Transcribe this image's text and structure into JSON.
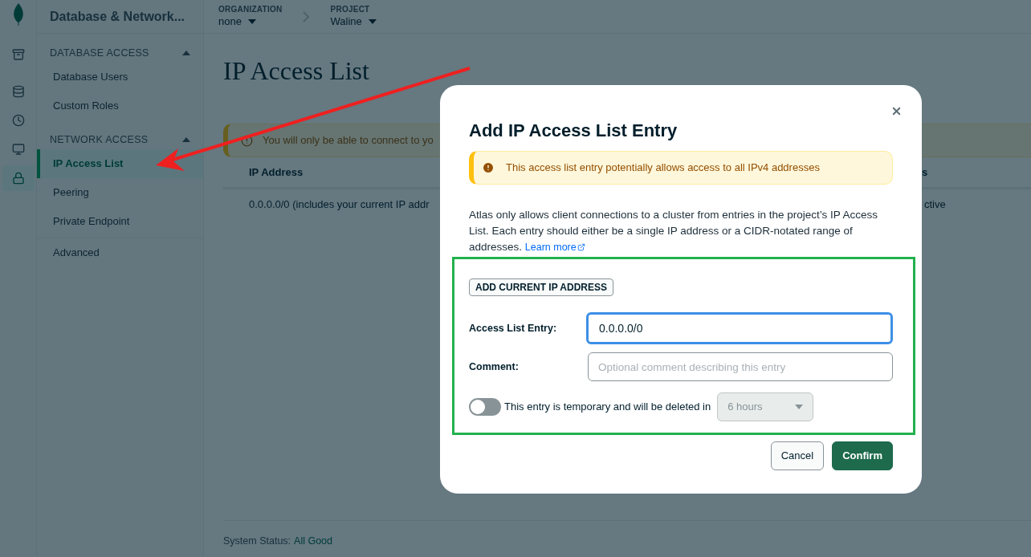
{
  "rail": [
    {
      "selected": false
    },
    {
      "selected": false
    },
    {
      "selected": false
    },
    {
      "selected": false
    },
    {
      "selected": true
    }
  ],
  "sidebar": {
    "title": "Database & Network...",
    "sections": [
      {
        "heading": "DATABASE ACCESS",
        "expanded": true,
        "items": [
          {
            "label": "Database Users",
            "selected": false
          },
          {
            "label": "Custom Roles",
            "selected": false
          }
        ]
      },
      {
        "heading": "NETWORK ACCESS",
        "expanded": true,
        "items": [
          {
            "label": "IP Access List",
            "selected": true
          },
          {
            "label": "Peering",
            "selected": false
          },
          {
            "label": "Private Endpoint",
            "selected": false
          }
        ]
      }
    ],
    "footer_items": [
      {
        "label": "Advanced",
        "selected": false
      }
    ]
  },
  "breadcrumb": [
    {
      "label": "ORGANIZATION",
      "value": "none"
    },
    {
      "label": "PROJECT",
      "value": "Waline"
    }
  ],
  "page": {
    "title": "IP Access List",
    "banner": "You will only be able to connect to yo",
    "table": {
      "columns": [
        "IP Address",
        "s"
      ],
      "rows": [
        [
          "0.0.0.0/0 (includes your current IP addr",
          "ctive"
        ]
      ]
    },
    "status_label": "System Status:",
    "status_value": "All Good"
  },
  "dialog": {
    "title": "Add IP Access List Entry",
    "warning": "This access list entry potentially allows access to all IPv4 addresses",
    "description": "Atlas only allows client connections to a cluster from entries in the project’s IP Access List. Each entry should either be a single IP address or a CIDR-notated range of addresses.",
    "link": "Learn more",
    "add_current_button": "ADD CURRENT IP ADDRESS",
    "entry": {
      "label": "Access List Entry:",
      "value": "0.0.0.0/0",
      "focused": true
    },
    "comment": {
      "label": "Comment:",
      "placeholder": "Optional comment describing this entry"
    },
    "temporary": {
      "on": false,
      "label": "This entry is temporary and will be deleted in",
      "duration": "6 hours",
      "disabled": true
    },
    "buttons": [
      {
        "label": "Cancel",
        "kind": "secondary"
      },
      {
        "label": "Confirm",
        "kind": "primary"
      }
    ]
  }
}
